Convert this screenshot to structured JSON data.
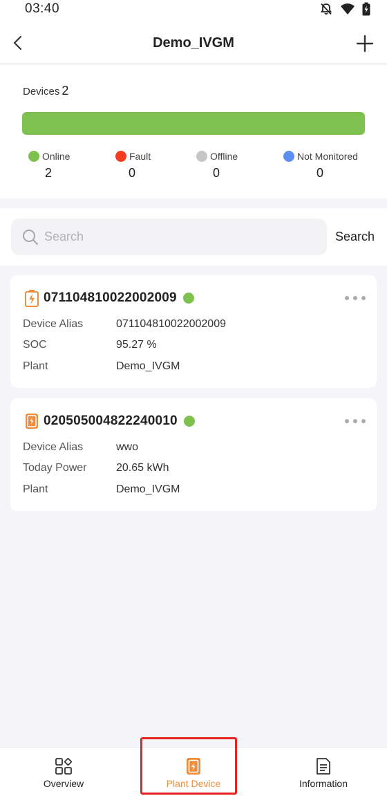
{
  "status_bar": {
    "time": "03:40"
  },
  "header": {
    "title": "Demo_IVGM"
  },
  "summary": {
    "devices_label": "Devices",
    "devices_count": "2",
    "online_fraction": 1.0,
    "stats": [
      {
        "label": "Online",
        "value": "2",
        "color": "#7fc14f"
      },
      {
        "label": "Fault",
        "value": "0",
        "color": "#f23b1f"
      },
      {
        "label": "Offline",
        "value": "0",
        "color": "#c6c6c6"
      },
      {
        "label": "Not Monitored",
        "value": "0",
        "color": "#5b8ff0"
      }
    ]
  },
  "search": {
    "placeholder": "Search",
    "button_label": "Search"
  },
  "devices": [
    {
      "sn": "071104810022002009",
      "icon": "battery-device-icon",
      "status_color": "#7fc14f",
      "rows": [
        {
          "key": "Device Alias",
          "value": "071104810022002009"
        },
        {
          "key": "SOC",
          "value": "95.27 %"
        },
        {
          "key": "Plant",
          "value": "Demo_IVGM"
        }
      ]
    },
    {
      "sn": "020505004822240010",
      "icon": "inverter-device-icon",
      "status_color": "#7fc14f",
      "rows": [
        {
          "key": "Device Alias",
          "value": "wwo"
        },
        {
          "key": "Today Power",
          "value": "20.65 kWh"
        },
        {
          "key": "Plant",
          "value": "Demo_IVGM"
        }
      ]
    }
  ],
  "bottom_nav": {
    "items": [
      {
        "label": "Overview",
        "icon": "overview-icon"
      },
      {
        "label": "Plant Device",
        "icon": "plant-device-icon",
        "active": true
      },
      {
        "label": "Information",
        "icon": "information-icon"
      }
    ]
  },
  "colors": {
    "accent": "#f08d3a",
    "online": "#7fc14f",
    "highlight": "#e8201f"
  }
}
